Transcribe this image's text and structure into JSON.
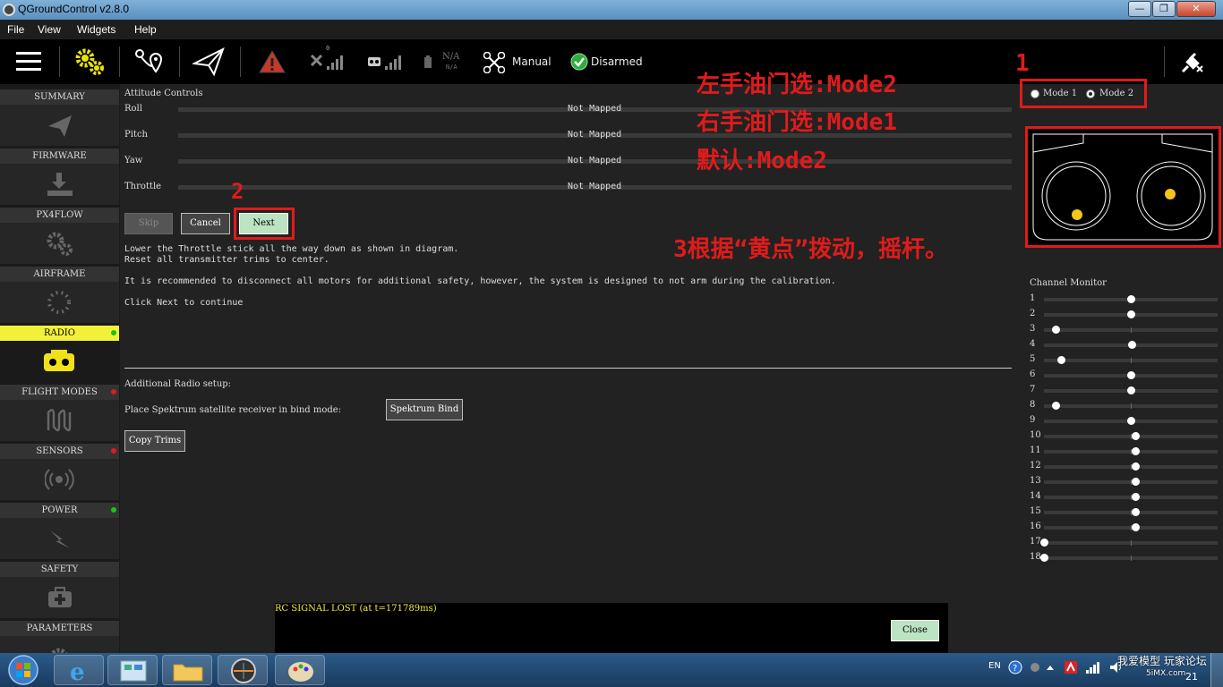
{
  "window": {
    "title": "QGroundControl v2.8.0",
    "buttons": [
      "—",
      "❐",
      "✕"
    ]
  },
  "menu": [
    "File",
    "View",
    "Widgets",
    "Help"
  ],
  "toolbar": {
    "battery": "N/A",
    "battery_sub": "N/A",
    "gps_count": "0",
    "flight_mode": "Manual",
    "arm_status": "Disarmed"
  },
  "sidebar": [
    {
      "label": "SUMMARY",
      "icon": "paper-plane-icon",
      "status": ""
    },
    {
      "label": "FIRMWARE",
      "icon": "download-icon",
      "status": ""
    },
    {
      "label": "PX4FLOW",
      "icon": "gears-icon",
      "status": ""
    },
    {
      "label": "AIRFRAME",
      "icon": "airframe-icon",
      "status": "#19c319"
    },
    {
      "label": "RADIO",
      "icon": "radio-icon",
      "status": "#19c319",
      "active": true
    },
    {
      "label": "FLIGHT MODES",
      "icon": "wave-icon",
      "status": "#e01b1b"
    },
    {
      "label": "SENSORS",
      "icon": "sensor-icon",
      "status": "#e01b1b"
    },
    {
      "label": "POWER",
      "icon": "power-icon",
      "status": "#19c319"
    },
    {
      "label": "SAFETY",
      "icon": "medkit-icon",
      "status": ""
    },
    {
      "label": "PARAMETERS",
      "icon": "gear-icon",
      "status": ""
    }
  ],
  "attitude": {
    "title": "Attitude Controls",
    "rows": [
      {
        "name": "Roll",
        "value": "Not Mapped"
      },
      {
        "name": "Pitch",
        "value": "Not Mapped"
      },
      {
        "name": "Yaw",
        "value": "Not Mapped"
      },
      {
        "name": "Throttle",
        "value": "Not Mapped"
      }
    ]
  },
  "buttons": {
    "skip": "Skip",
    "cancel": "Cancel",
    "next": "Next",
    "spektrum": "Spektrum Bind",
    "copy_trims": "Copy Trims",
    "close": "Close"
  },
  "instructions": {
    "line1": "Lower the Throttle stick all the way down as shown in diagram.",
    "line2": "Reset all transmitter trims to center.",
    "line3": "It is recommended to disconnect all motors for additional safety, however, the system is designed to not arm during the calibration.",
    "line4": "Click Next to continue"
  },
  "additional": {
    "title": "Additional Radio setup:",
    "bind_label": "Place Spektrum satellite receiver in bind mode:"
  },
  "modes": {
    "mode1": "Mode 1",
    "mode2": "Mode 2",
    "selected": "Mode 2"
  },
  "annotations": {
    "n1": "1",
    "n2": "2",
    "left": "左手油门选:Mode2",
    "right": "右手油门选:Mode1",
    "default": "默认:Mode2",
    "step3": "3根据“黄点”拨动，摇杆。"
  },
  "channel_monitor": {
    "title": "Channel Monitor",
    "channels": [
      {
        "n": "1",
        "v": 0.5
      },
      {
        "n": "2",
        "v": 0.5
      },
      {
        "n": "3",
        "v": 0.07
      },
      {
        "n": "4",
        "v": 0.51
      },
      {
        "n": "5",
        "v": 0.1
      },
      {
        "n": "6",
        "v": 0.5
      },
      {
        "n": "7",
        "v": 0.5
      },
      {
        "n": "8",
        "v": 0.07
      },
      {
        "n": "9",
        "v": 0.5
      },
      {
        "n": "10",
        "v": 0.53
      },
      {
        "n": "11",
        "v": 0.53
      },
      {
        "n": "12",
        "v": 0.53
      },
      {
        "n": "13",
        "v": 0.53
      },
      {
        "n": "14",
        "v": 0.53
      },
      {
        "n": "15",
        "v": 0.53
      },
      {
        "n": "16",
        "v": 0.53
      },
      {
        "n": "17",
        "v": 0.0
      },
      {
        "n": "18",
        "v": 0.0
      }
    ]
  },
  "status_message": "RC SIGNAL LOST (at t=171789ms)",
  "taskbar": {
    "lang": "EN",
    "watermark": "我爱模型 玩家论坛",
    "watermark_sub": "5iMX.com",
    "clock": "21"
  },
  "colors": {
    "accent_yellow": "#f1f13a",
    "annotation_red": "#e01b1b",
    "stick_dot": "#f5c518"
  }
}
